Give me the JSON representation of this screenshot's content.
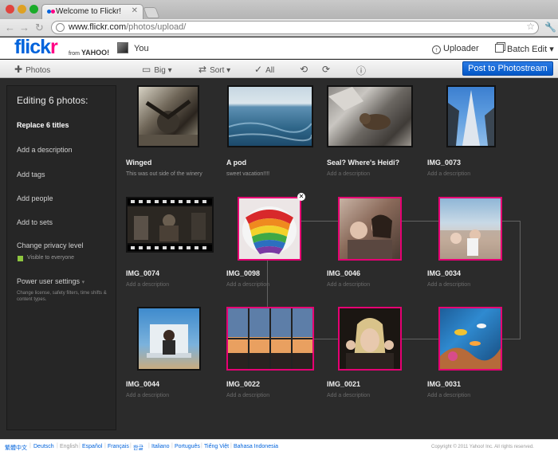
{
  "browser": {
    "tab_title": "Welcome to Flickr!",
    "url_host": "www.flickr.com",
    "url_path": "/photos/upload/"
  },
  "header": {
    "logo_a": "flick",
    "logo_b": "r",
    "from": "from",
    "yahoo": "YAHOO!",
    "you": "You",
    "uploader": "Uploader",
    "batch_edit": "Batch Edit ▾"
  },
  "toolbar": {
    "photos": "Photos",
    "big": "Big ▾",
    "sort": "Sort ▾",
    "all": "All",
    "post": "Post to Photostream"
  },
  "sidebar": {
    "editing": "Editing 6 photos:",
    "replace_titles": "Replace 6 titles",
    "add_description": "Add a description",
    "add_tags": "Add tags",
    "add_people": "Add people",
    "add_sets": "Add to sets",
    "privacy": "Change privacy level",
    "visible": "Visible to everyone",
    "power": "Power user settings",
    "power_desc": "Change license, safety filters, time shifts & content types."
  },
  "photos": [
    {
      "title": "Winged",
      "desc": "This was out side of the winery",
      "selected": false
    },
    {
      "title": "A pod",
      "desc": "sweet vacation!!!!",
      "selected": false
    },
    {
      "title": "Seal? Where's Heidi?",
      "desc": "Add a description",
      "selected": false
    },
    {
      "title": "IMG_0073",
      "desc": "Add a description",
      "selected": false
    },
    {
      "title": "IMG_0074",
      "desc": "Add a description",
      "selected": false
    },
    {
      "title": "IMG_0098",
      "desc": "Add a description",
      "selected": true
    },
    {
      "title": "IMG_0046",
      "desc": "Add a description",
      "selected": true
    },
    {
      "title": "IMG_0034",
      "desc": "Add a description",
      "selected": true
    },
    {
      "title": "IMG_0044",
      "desc": "Add a description",
      "selected": false
    },
    {
      "title": "IMG_0022",
      "desc": "Add a description",
      "selected": true
    },
    {
      "title": "IMG_0021",
      "desc": "Add a description",
      "selected": true
    },
    {
      "title": "IMG_0031",
      "desc": "Add a description",
      "selected": true
    }
  ],
  "footer": {
    "languages": [
      "繁體中文",
      "Deutsch",
      "English",
      "Español",
      "Français",
      "한글",
      "Italiano",
      "Português",
      "Tiếng Việt",
      "Bahasa Indonesia"
    ],
    "current_language": "English",
    "copyright": "Copyright © 2011 Yahoo! Inc. All rights reserved."
  },
  "colors": {
    "flickr_blue": "#0063dc",
    "flickr_pink": "#ff0084",
    "selection": "#e60073",
    "post_button": "#0056c6"
  }
}
